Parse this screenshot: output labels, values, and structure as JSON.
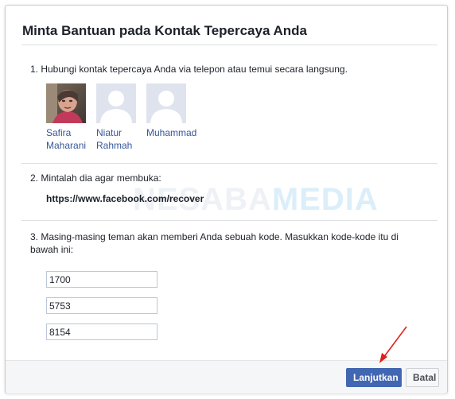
{
  "dialog": {
    "title": "Minta Bantuan pada Kontak Tepercaya Anda",
    "step1": "1. Hubungi kontak tepercaya Anda via telepon atau temui secara langsung.",
    "contacts": [
      {
        "line1": "Safira",
        "line2": "Maharani",
        "avatar": "photo"
      },
      {
        "line1": "Niatur",
        "line2": "Rahmah",
        "avatar": "default-silhouette"
      },
      {
        "line1": "Muhammad",
        "line2": "",
        "avatar": "default-silhouette"
      }
    ],
    "step2": "2. Mintalah dia agar membuka:",
    "url": "https://www.facebook.com/recover",
    "step3_line1": "3. Masing-masing teman akan memberi Anda sebuah kode. Masukkan kode-kode itu di",
    "step3_line2": "bawah ini:",
    "codes": [
      "1700",
      "5753",
      "8154"
    ]
  },
  "watermark": {
    "part1": "NESABA",
    "part2": "MEDIA"
  },
  "footer": {
    "continue_label": "Lanjutkan",
    "cancel_label": "Batal"
  },
  "colors": {
    "primary": "#4267b2",
    "link": "#365899",
    "annotation_arrow": "#e0201b"
  }
}
